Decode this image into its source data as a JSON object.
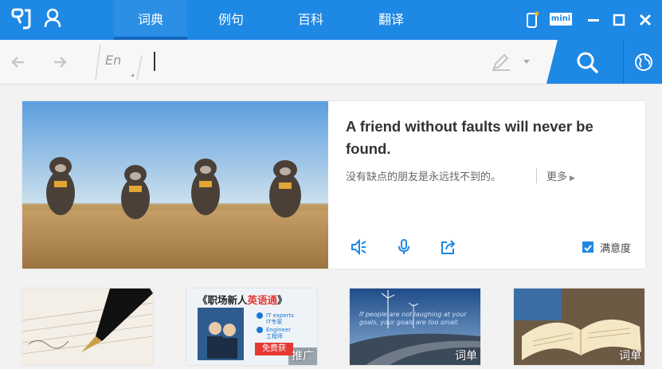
{
  "app": {
    "accent_color": "#1e88e5",
    "icons": [
      "logo-icon",
      "user-icon",
      "phone-icon",
      "minimize-icon",
      "maximize-icon",
      "close-icon"
    ]
  },
  "tabs": [
    {
      "label": "词典",
      "active": true
    },
    {
      "label": "例句",
      "active": false
    },
    {
      "label": "百科",
      "active": false
    },
    {
      "label": "翻译",
      "active": false
    }
  ],
  "window": {
    "mini_label": "mini"
  },
  "search": {
    "lang_label": "En",
    "value": "",
    "icons": [
      "back-arrow-icon",
      "forward-arrow-icon",
      "pen-icon",
      "dropdown-arrow-icon",
      "search-icon",
      "globe-icon"
    ]
  },
  "daily": {
    "quote_en": "A friend without faults will never be found.",
    "quote_zh": "没有缺点的朋友是永远找不到的。",
    "more_label": "更多",
    "satisfaction_label": "满意度",
    "satisfaction_checked": true,
    "action_icons": [
      "speaker-icon",
      "microphone-icon",
      "share-icon"
    ]
  },
  "thumbnails": [
    {
      "tag": ""
    },
    {
      "title_prefix": "《职场新人",
      "title_highlight": "英语通",
      "title_suffix": "》",
      "labels": [
        "IT experts",
        "IT专家",
        "Engineer",
        "工程师"
      ],
      "button": "免费获",
      "tag": "推广"
    },
    {
      "text": "If people are not laughing at your goals, your goals are too small.",
      "tag": "词单"
    },
    {
      "tag": "词单"
    }
  ]
}
